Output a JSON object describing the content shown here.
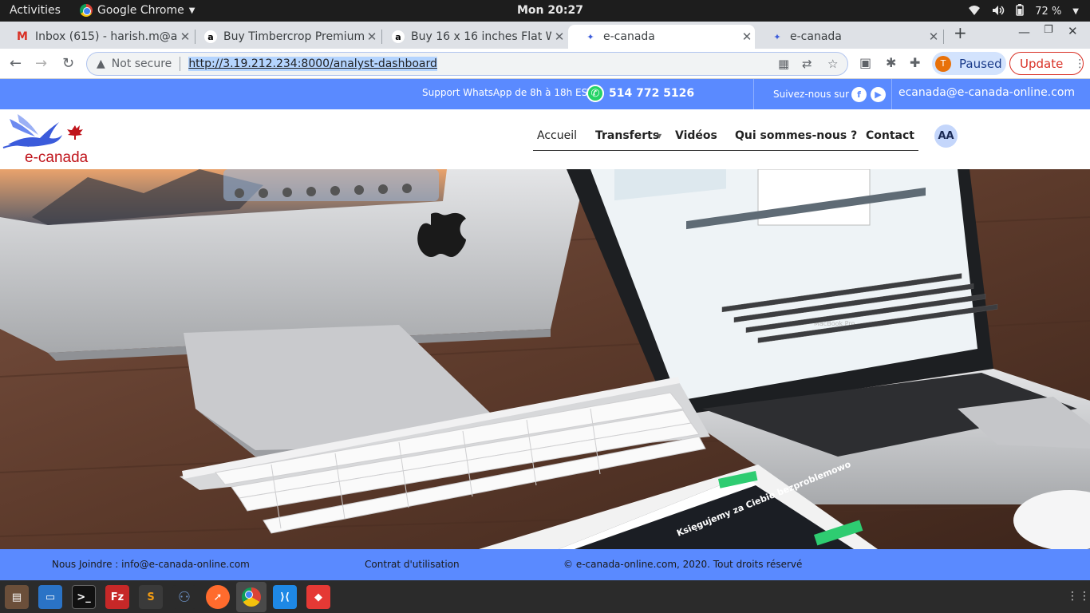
{
  "system_bar": {
    "activities": "Activities",
    "app_name": "Google Chrome",
    "clock": "Mon 20:27",
    "battery": "72 %"
  },
  "tabs": [
    {
      "title": "Inbox (615) - harish.m@a",
      "favicon": "gmail-icon"
    },
    {
      "title": "Buy Timbercrop Premium",
      "favicon": "amazon-icon"
    },
    {
      "title": "Buy 16 x 16 inches Flat W",
      "favicon": "amazon-icon"
    },
    {
      "title": "e-canada",
      "favicon": "e-canada-icon"
    },
    {
      "title": "e-canada",
      "favicon": "e-canada-icon"
    }
  ],
  "omnibox": {
    "security": "Not secure",
    "url": "http://3.19.212.234:8000/analyst-dashboard"
  },
  "profile": {
    "initial": "T",
    "label": "Paused"
  },
  "update_label": "Update",
  "site": {
    "support_text": "Support WhatsApp de 8h à 18h EST",
    "phone": "514 772 5126",
    "follow_text": "Suivez-nous sur",
    "email": "ecanada@e-canada-online.com",
    "logo_text": "e-canada",
    "nav": {
      "home": "Accueil",
      "transfers": "Transferts",
      "videos": "Vidéos",
      "about": "Qui sommes-nous ?",
      "contact": "Contact"
    },
    "user_initials": "AA",
    "footer": {
      "contact": "Nous Joindre : info@e-canada-online.com",
      "terms": "Contrat d'utilisation",
      "copyright": "© e-canada-online.com, 2020. Tout droits réservé"
    }
  },
  "hero_image": {
    "laptop_label": "MacBook Pro",
    "tablet_heading": "Księgujemy za Ciebie bezproblemowo"
  },
  "colors": {
    "brand_blue": "#5a8aff",
    "logo_red": "#c0151c"
  }
}
